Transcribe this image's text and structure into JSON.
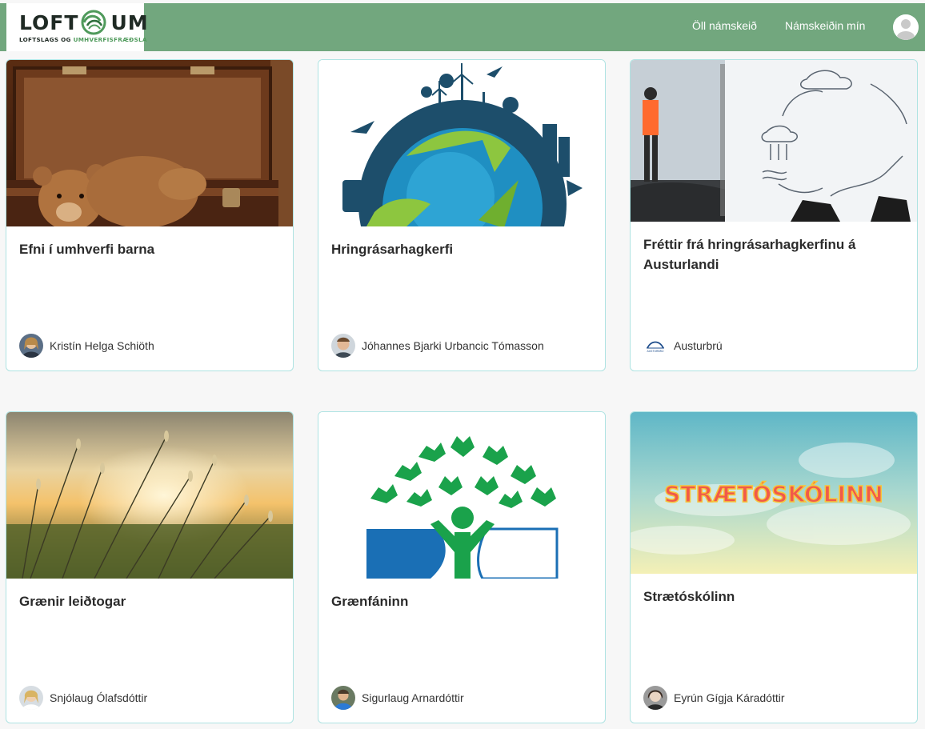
{
  "header": {
    "logo": {
      "word_left": "LOFT",
      "word_right": "UM",
      "tagline_dark": "LOFTSLAGS OG ",
      "tagline_green": "UMHVERFISFRÆÐSLA"
    },
    "nav": [
      {
        "label": "Öll námskeið"
      },
      {
        "label": "Námskeiðin mín"
      }
    ],
    "user_avatar_icon": "user-avatar-icon"
  },
  "colors": {
    "header_bg": "#72a77e",
    "card_border": "#aee3e2",
    "page_bg": "#f7f7f7"
  },
  "courses": [
    {
      "title": "Efni í umhverfi barna",
      "author": "Kristín Helga Schiöth",
      "image": "teddy-bear-in-suitcase"
    },
    {
      "title": "Hringrásarhagkerfi",
      "author": "Jóhannes Bjarki Urbancic Tómasson",
      "image": "recycling-globe"
    },
    {
      "title": "Fréttir frá hringrásarhagkerfinu á Austurlandi",
      "author": "Austurbrú",
      "image": "person-with-water-cycle-sketch",
      "author_logo_text": "AUSTURBRÚ"
    },
    {
      "title": "Grænir leiðtogar",
      "author": "Snjólaug Ólafsdóttir",
      "image": "grass-at-sunset"
    },
    {
      "title": "Grænfáninn",
      "author": "Sigurlaug Arnardóttir",
      "image": "green-flag-tree-logo"
    },
    {
      "title": "Strætóskólinn",
      "author": "Eyrún Gígja Káradóttir",
      "image": "straetoskolinn-banner",
      "image_text": "STRÆTÓSKÓLINN"
    }
  ]
}
